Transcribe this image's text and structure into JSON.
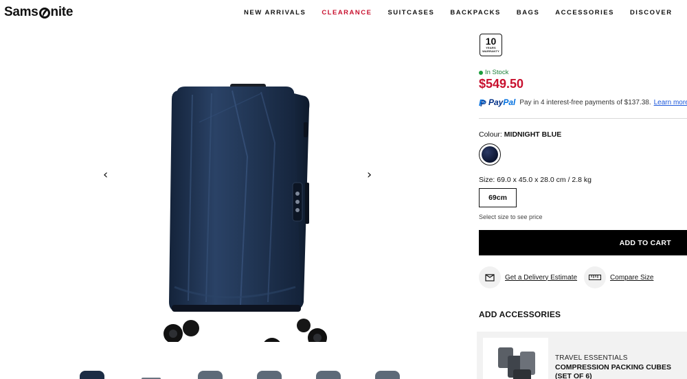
{
  "brand": {
    "logo_before": "Sams",
    "logo_after": "nite"
  },
  "nav": {
    "items": [
      {
        "label": "NEW ARRIVALS"
      },
      {
        "label": "CLEARANCE",
        "color": "#c8102e"
      },
      {
        "label": "SUITCASES"
      },
      {
        "label": "BACKPACKS"
      },
      {
        "label": "BAGS"
      },
      {
        "label": "ACCESSORIES"
      },
      {
        "label": "DISCOVER"
      }
    ]
  },
  "gallery": {
    "prev_icon": "‹",
    "next_icon": "›",
    "product_color": "#1c2d45",
    "thumbnail_count": 6
  },
  "product": {
    "warranty_number": "10",
    "warranty_line1": "YEARS",
    "warranty_line2": "WARRANTY",
    "stock_status": "In Stock",
    "price": "$549.50",
    "price_color": "#c8102e",
    "paypal": {
      "brand_pay": "Pay",
      "brand_pal": "Pal",
      "message": "Pay in 4 interest-free payments of $137.38.",
      "learn_more": "Learn more"
    },
    "colour": {
      "label": "Colour:",
      "value": "MIDNIGHT BLUE"
    },
    "size": {
      "label": "Size: 69.0 x 45.0 x 28.0 cm / 2.8 kg",
      "option": "69cm",
      "hint": "Select size to see price"
    },
    "add_to_cart": "ADD TO CART",
    "delivery_estimate": "Get a Delivery Estimate",
    "compare_size": "Compare Size"
  },
  "accessories": {
    "title": "ADD ACCESSORIES",
    "items": [
      {
        "category": "TRAVEL ESSENTIALS",
        "name": "COMPRESSION PACKING CUBES (SET OF 6)"
      }
    ]
  }
}
